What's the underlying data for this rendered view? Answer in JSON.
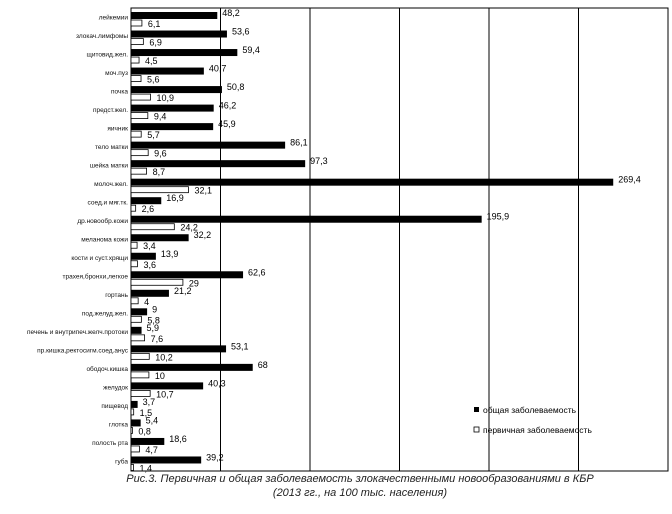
{
  "chart_data": {
    "type": "bar",
    "orientation": "horizontal",
    "categories": [
      "лейкемии",
      "злокач.лимфомы",
      "щитовид.жел.",
      "моч.пуз",
      "почка",
      "предст.жел.",
      "яичник",
      "тело матки",
      "шейка матки",
      "молоч.жел.",
      "соед.и мяг.тк.",
      "др.новообр.кожи",
      "меланома кожи",
      "кости и суст.хрящи",
      "трахея,бронхи,легкое",
      "гортань",
      "под.желуд.жел.",
      "печень и внутрипеч.желч.протоки",
      "пр.кишка,ректосигм.соед.анус",
      "ободоч.кишка",
      "желудок",
      "пищевод",
      "глотка",
      "полость рта",
      "губа"
    ],
    "series": [
      {
        "name": "общая заболеваемость",
        "color": "#000000",
        "values": [
          48.2,
          53.6,
          59.4,
          40.7,
          50.8,
          46.2,
          45.9,
          86.1,
          97.3,
          269.4,
          16.9,
          195.9,
          32.2,
          13.9,
          62.6,
          21.2,
          9,
          5.9,
          53.1,
          68,
          40.3,
          3.7,
          5.4,
          18.6,
          39.2
        ],
        "labels": [
          "48,2",
          "53,6",
          "59,4",
          "40,7",
          "50,8",
          "46,2",
          "45,9",
          "86,1",
          "97,3",
          "269,4",
          "16,9",
          "195,9",
          "32,2",
          "13,9",
          "62,6",
          "21,2",
          "9",
          "5,9",
          "53,1",
          "68",
          "40,3",
          "3,7",
          "5,4",
          "18,6",
          "39,2"
        ]
      },
      {
        "name": "первичная заболеваемость",
        "color": "#ffffff",
        "values": [
          6.1,
          6.9,
          4.5,
          5.6,
          10.9,
          9.4,
          5.7,
          9.6,
          8.7,
          32.1,
          2.6,
          24.2,
          3.4,
          3.6,
          29,
          4,
          5.8,
          7.6,
          10.2,
          10,
          10.7,
          1.5,
          0.8,
          4.7,
          1.4
        ],
        "labels": [
          "6,1",
          "6,9",
          "4,5",
          "5,6",
          "10,9",
          "9,4",
          "5,7",
          "9,6",
          "8,7",
          "32,1",
          "2,6",
          "24,2",
          "3,4",
          "3,6",
          "29",
          "4",
          "5,8",
          "7,6",
          "10,2",
          "10",
          "10,7",
          "1,5",
          "0,8",
          "4,7",
          "1,4"
        ]
      }
    ],
    "xlim": [
      0,
      300
    ],
    "grid": true,
    "legend_position": "bottom-right",
    "caption": [
      "Рис.3. Первичная и общая заболеваемость злокачественными новообразованиями в КБР",
      "(2013 гг., на 100 тыс. населения)"
    ]
  }
}
